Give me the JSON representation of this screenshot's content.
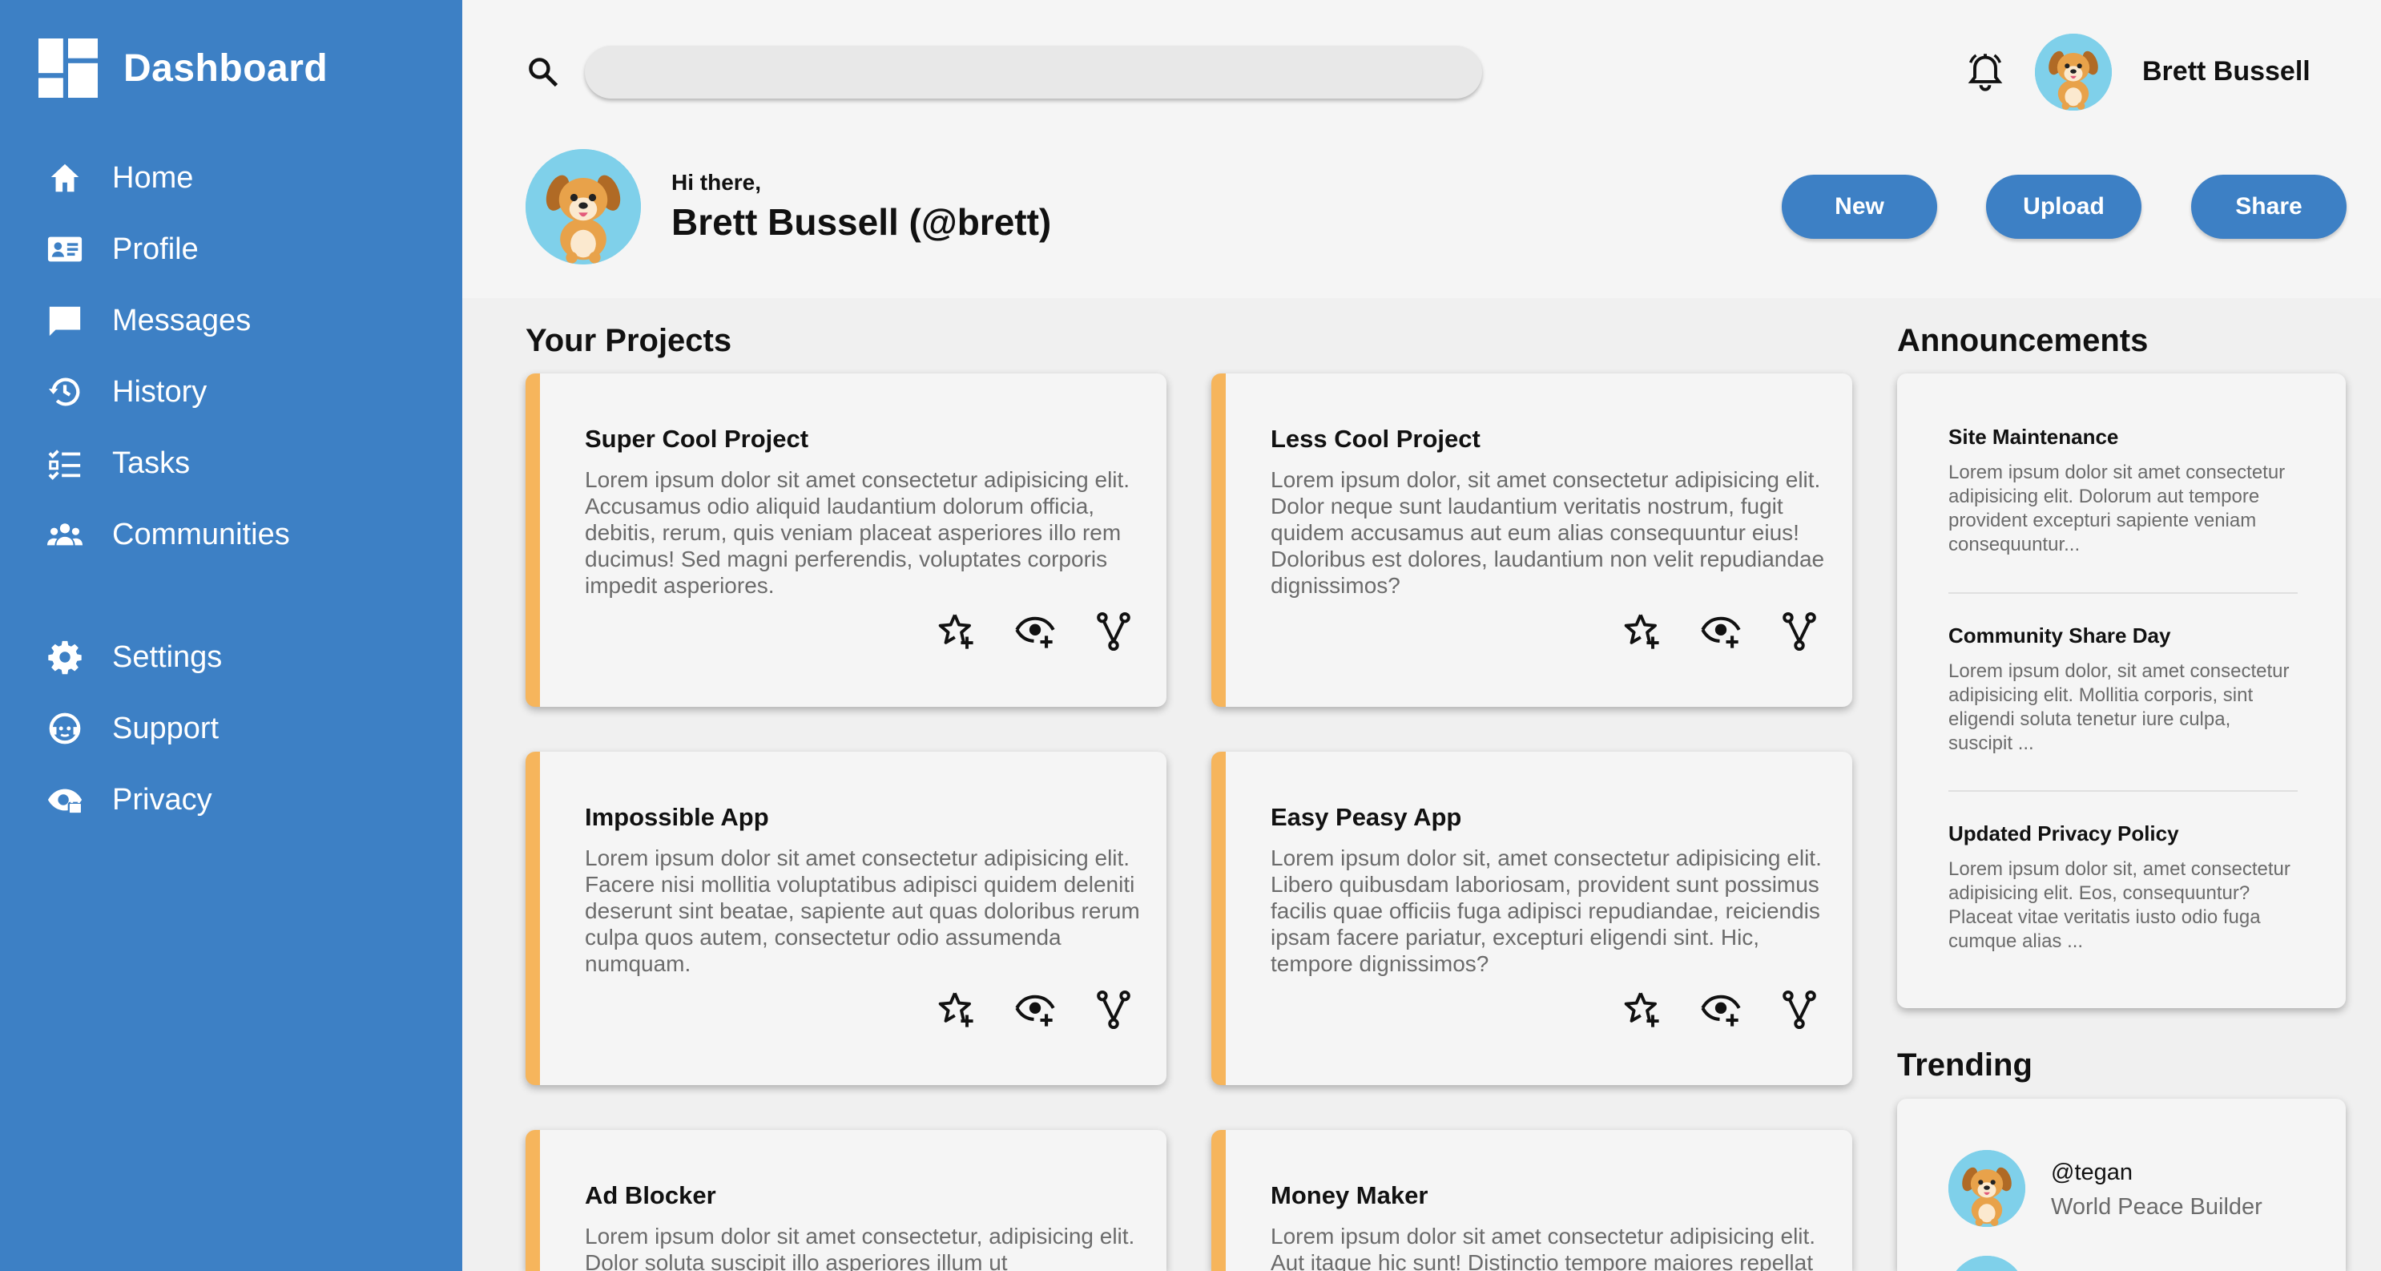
{
  "sidebar": {
    "title": "Dashboard",
    "items": [
      {
        "label": "Home",
        "icon": "home-icon"
      },
      {
        "label": "Profile",
        "icon": "id-card-icon"
      },
      {
        "label": "Messages",
        "icon": "chat-icon"
      },
      {
        "label": "History",
        "icon": "history-icon"
      },
      {
        "label": "Tasks",
        "icon": "checklist-icon"
      },
      {
        "label": "Communities",
        "icon": "people-icon"
      },
      {
        "label": "Settings",
        "icon": "gear-icon"
      },
      {
        "label": "Support",
        "icon": "support-icon"
      },
      {
        "label": "Privacy",
        "icon": "privacy-icon"
      }
    ]
  },
  "header": {
    "search": {
      "placeholder": "",
      "value": ""
    },
    "username": "Brett Bussell",
    "greeting": "Hi there,",
    "display_name": "Brett Bussell (@brett)",
    "buttons": {
      "new": "New",
      "upload": "Upload",
      "share": "Share"
    }
  },
  "projects": {
    "title": "Your Projects",
    "cards": [
      {
        "title": "Super Cool Project",
        "desc": "Lorem ipsum dolor sit amet consectetur adipisicing elit. Accusamus odio aliquid laudantium dolorum officia, debitis, rerum, quis veniam placeat asperiores illo rem ducimus! Sed magni perferendis, voluptates corporis impedit asperiores."
      },
      {
        "title": "Less Cool Project",
        "desc": "Lorem ipsum dolor, sit amet consectetur adipisicing elit. Dolor neque sunt laudantium veritatis nostrum, fugit quidem accusamus aut eum alias consequuntur eius! Doloribus est dolores, laudantium non velit repudiandae dignissimos?"
      },
      {
        "title": "Impossible App",
        "desc": "Lorem ipsum dolor sit amet consectetur adipisicing elit. Facere nisi mollitia voluptatibus adipisci quidem deleniti deserunt sint beatae, sapiente aut quas doloribus rerum culpa quos autem, consectetur odio assumenda numquam."
      },
      {
        "title": "Easy Peasy App",
        "desc": "Lorem ipsum dolor sit, amet consectetur adipisicing elit. Libero quibusdam laboriosam, provident sunt possimus facilis quae officiis fuga adipisci repudiandae, reiciendis ipsam facere pariatur, excepturi eligendi sint. Hic, tempore dignissimos?"
      },
      {
        "title": "Ad Blocker",
        "desc": "Lorem ipsum dolor sit amet consectetur, adipisicing elit. Dolor soluta suscipit illo asperiores illum ut"
      },
      {
        "title": "Money Maker",
        "desc": "Lorem ipsum dolor sit amet consectetur adipisicing elit. Aut itaque hic sunt! Distinctio tempore maiores repellat"
      }
    ]
  },
  "announcements": {
    "title": "Announcements",
    "items": [
      {
        "title": "Site Maintenance",
        "body": "Lorem ipsum dolor sit amet consectetur adipisicing elit. Dolorum aut tempore provident excepturi sapiente veniam consequuntur..."
      },
      {
        "title": "Community Share Day",
        "body": "Lorem ipsum dolor, sit amet consectetur adipisicing elit. Mollitia corporis, sint eligendi soluta tenetur iure culpa, suscipit ..."
      },
      {
        "title": "Updated Privacy Policy",
        "body": "Lorem ipsum dolor sit, amet consectetur adipisicing elit. Eos, consequuntur? Placeat vitae veritatis iusto odio fuga cumque alias ..."
      }
    ]
  },
  "trending": {
    "title": "Trending",
    "items": [
      {
        "handle": "@tegan",
        "subtitle": "World Peace Builder"
      }
    ]
  },
  "colors": {
    "accent": "#3d80c5",
    "card_stripe": "#f6b55c",
    "avatar_bg": "#7fd0ea"
  }
}
